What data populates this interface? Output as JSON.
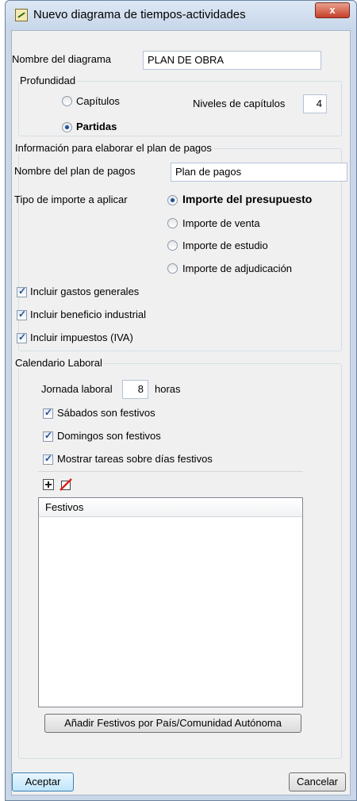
{
  "window": {
    "title": "Nuevo diagrama de tiempos-actividades",
    "close_label": "x"
  },
  "diagram_name": {
    "label": "Nombre del diagrama",
    "value": "PLAN DE OBRA"
  },
  "depth": {
    "title": "Profundidad",
    "options": [
      {
        "label": "Capítulos",
        "checked": false
      },
      {
        "label": "Partidas",
        "checked": true
      }
    ],
    "levels_label": "Niveles de capítulos",
    "levels_value": "4"
  },
  "payment_plan": {
    "title": "Información para elaborar el plan de pagos",
    "name_label": "Nombre del plan de pagos",
    "name_value": "Plan de pagos",
    "amount_type_label": "Tipo de importe a aplicar",
    "amount_options": [
      {
        "label": "Importe del presupuesto",
        "checked": true
      },
      {
        "label": "Importe de venta",
        "checked": false
      },
      {
        "label": "Importe de estudio",
        "checked": false
      },
      {
        "label": "Importe de adjudicación",
        "checked": false
      }
    ],
    "checkboxes": [
      {
        "label": "Incluir gastos generales",
        "checked": true
      },
      {
        "label": "Incluir beneficio industrial",
        "checked": true
      },
      {
        "label": "Incluir impuestos (IVA)",
        "checked": true
      }
    ]
  },
  "calendar": {
    "title": "Calendario Laboral",
    "workday_label": "Jornada laboral",
    "workday_value": "8",
    "workday_unit": "horas",
    "checkboxes": [
      {
        "label": "Sábados son festivos",
        "checked": true
      },
      {
        "label": "Domingos son festivos",
        "checked": true
      },
      {
        "label": "Mostrar tareas sobre días festivos",
        "checked": true
      }
    ],
    "toolbar_icons": [
      "add-icon",
      "delete-icon"
    ],
    "holidays_header": "Festivos",
    "holidays": [],
    "add_holidays_button": "Añadir Festivos por País/Comunidad Autónoma"
  },
  "buttons": {
    "accept": "Aceptar",
    "cancel": "Cancelar"
  },
  "colors": {
    "titlebar": "#c7d6ea",
    "close_button": "#c7402a",
    "dialog_background": "#f0f0f0",
    "radio_dot": "#1f4f9e",
    "default_button": "#bee6fd"
  }
}
